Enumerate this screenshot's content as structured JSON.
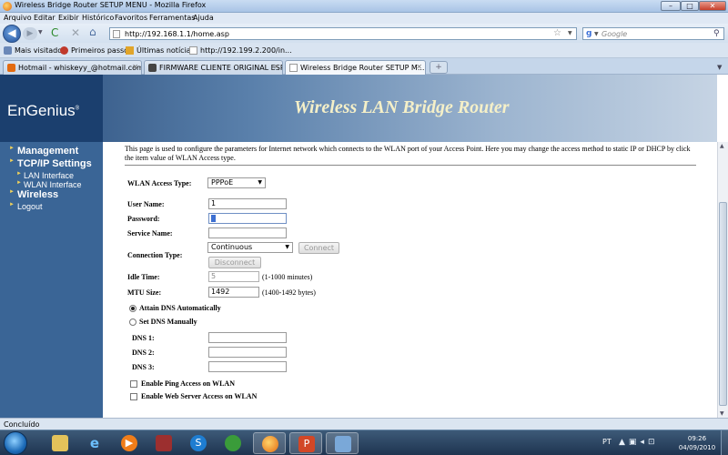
{
  "window": {
    "title": "Wireless Bridge Router SETUP MENU - Mozilla Firefox",
    "min": "–",
    "max": "□",
    "close": "✕"
  },
  "menu": [
    "Arquivo",
    "Editar",
    "Exibir",
    "Histórico",
    "Favoritos",
    "Ferramentas",
    "Ajuda"
  ],
  "nav": {
    "url": "http://192.168.1.1/home.asp",
    "search_placeholder": "Google",
    "search_engine": "g",
    "back": "◀",
    "forward": "▶",
    "reload": "C",
    "stop": "✕",
    "home": "⌂",
    "star": "☆"
  },
  "bookmarks": [
    "Mais visitados",
    "Primeiros passos",
    "Últimas notícias",
    "http://192.199.2.200/in..."
  ],
  "tabs": [
    {
      "label": "Hotmail - whiskeyy_@hotmail.com ...",
      "active": false
    },
    {
      "label": "FIRMWARE CLIENTE ORIGINAL ESR...",
      "active": false
    },
    {
      "label": "Wireless Bridge Router SETUP M...",
      "active": true
    }
  ],
  "header": {
    "logo": "EnGenius",
    "logo_mark": "®",
    "title": "Wireless LAN Bridge Router"
  },
  "sidebar": {
    "management": "Management",
    "tcpip": "TCP/IP Settings",
    "lan": "LAN Interface",
    "wlan": "WLAN Interface",
    "wireless": "Wireless",
    "logout": "Logout",
    "bullet": "►"
  },
  "form": {
    "description": "This page is used to configure the parameters for Internet network which connects to the WLAN port of your Access Point. Here you may change the access method to static IP or DHCP by click the item value of WLAN Access type.",
    "access_type_label": "WLAN Access Type:",
    "access_type_value": "PPPoE",
    "username_label": "User Name:",
    "username_value": "1",
    "password_label": "Password:",
    "service_label": "Service Name:",
    "connection_label": "Connection Type:",
    "connection_value": "Continuous",
    "connect_btn": "Connect",
    "disconnect_btn": "Disconnect",
    "idle_label": "Idle Time:",
    "idle_value": "5",
    "idle_hint": "(1-1000 minutes)",
    "mtu_label": "MTU Size:",
    "mtu_value": "1492",
    "mtu_hint": "(1400-1492 bytes)",
    "dns_auto": "Attain DNS Automatically",
    "dns_manual": "Set DNS Manually",
    "dns1_label": "DNS 1:",
    "dns2_label": "DNS 2:",
    "dns3_label": "DNS 3:",
    "ping_label": "Enable Ping Access on WLAN",
    "web_label": "Enable Web Server Access on WLAN"
  },
  "status": "Concluído",
  "taskbar": {
    "lang": "PT",
    "time": "09:26",
    "date": "04/09/2010"
  }
}
